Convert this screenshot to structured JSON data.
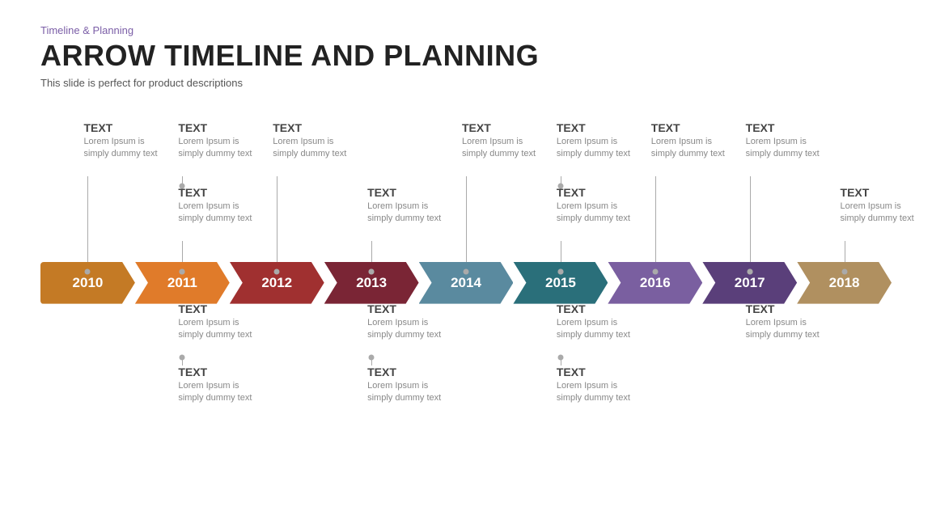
{
  "header": {
    "subtitle": "Timeline  & Planning",
    "title": "ARROW TIMELINE AND PLANNING",
    "description": "This slide is perfect for product descriptions"
  },
  "years": [
    {
      "year": "2010",
      "color": "#c47a25"
    },
    {
      "year": "2011",
      "color": "#e07b2a"
    },
    {
      "year": "2012",
      "color": "#a03030"
    },
    {
      "year": "2013",
      "color": "#7a2535"
    },
    {
      "year": "2014",
      "color": "#5a8a9f"
    },
    {
      "year": "2015",
      "color": "#2a6f7a"
    },
    {
      "year": "2016",
      "color": "#7a5fa0"
    },
    {
      "year": "2017",
      "color": "#5a3f7a"
    },
    {
      "year": "2018",
      "color": "#b09060"
    }
  ],
  "label": "TEXT",
  "body": "Lorem Ipsum  is simply dummy  text"
}
